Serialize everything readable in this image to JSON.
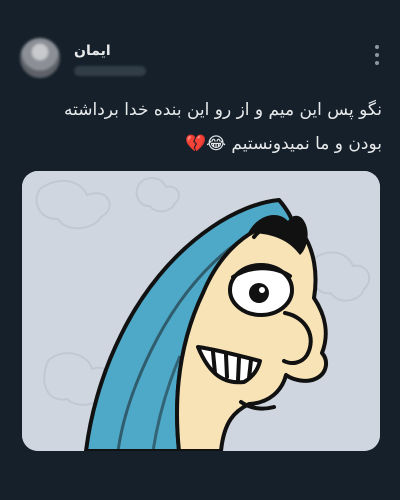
{
  "post": {
    "author_name": "ایمان",
    "text": "نگو پس این میم و از رو این بنده خدا برداشته\nبودن و ما نمیدونستیم 😂💔"
  },
  "icons": {
    "more": "more-vertical-icon"
  },
  "colors": {
    "background": "#15202b",
    "text": "#e7e9ea",
    "secondary": "#8b98a5"
  }
}
